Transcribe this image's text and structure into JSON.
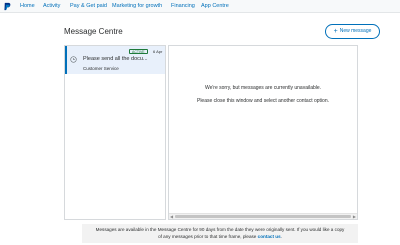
{
  "nav": {
    "items": [
      {
        "label": "Home"
      },
      {
        "label": "Activity"
      },
      {
        "label": "Pay & Get paid"
      },
      {
        "label": "Marketing for growth"
      },
      {
        "label": "Financing"
      },
      {
        "label": "App Centre"
      }
    ],
    "logo_icon": "paypal-logo-icon",
    "accent_color": "#0070ba"
  },
  "page": {
    "title": "Message Centre",
    "new_message_label": "New message",
    "new_message_icon": "plus-icon"
  },
  "messages": [
    {
      "badge": "ACTIVE",
      "date": "6 Apr",
      "subject": "Please send all the docu...",
      "sender": "Customer Service",
      "icon": "message-clock-icon"
    }
  ],
  "detail": {
    "line1": "We're sorry, but messages are currently unavailable.",
    "line2": "Please close this window and select another contact option."
  },
  "footer": {
    "line1": "Messages are available in the Message Centre for 90 days from the date they were originally sent. If you would like a copy",
    "line2_prefix": "of any messages prior to that time frame, please",
    "line2_link": "contact us",
    "line2_suffix": "."
  }
}
